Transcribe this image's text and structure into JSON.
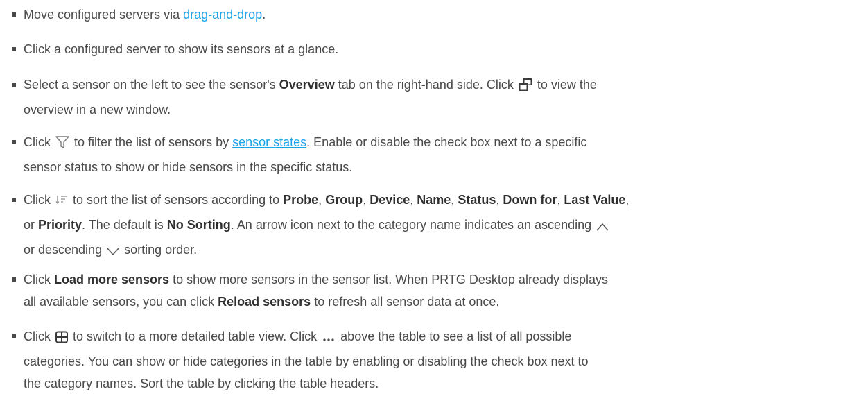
{
  "items": [
    {
      "t0": "Move configured servers via ",
      "link": "drag-and-drop",
      "t1": "."
    },
    {
      "t0": "Click a configured server to show its sensors at a glance."
    },
    {
      "t0": "Select a sensor on the left to see the sensor's ",
      "b0": "Overview",
      "t1": " tab on the right-hand side. Click ",
      "t2": " to view the",
      "t3": "overview in a new window."
    },
    {
      "t0": "Click ",
      "t1": " to filter the list of sensors by ",
      "link": "sensor states",
      "t2": ". Enable or disable the check box next to a specific",
      "t3": "sensor status to show or hide sensors in the specific status."
    },
    {
      "t0": "Click ",
      "t1": " to sort the list of sensors according to ",
      "probe": "Probe",
      "group": "Group",
      "device": "Device",
      "name": "Name",
      "status": "Status",
      "down_for": "Down for",
      "last_value": "Last Value",
      "priority": "Priority",
      "sep": ", ",
      "or": "or ",
      "default_pre": ". The default is ",
      "no_sorting": "No Sorting",
      "t2": ". An arrow icon next to the category name indicates an ascending",
      "t3": "or descending",
      "t4": " sorting order."
    },
    {
      "t0": "Click ",
      "b0": "Load more sensors",
      "t1": " to show more sensors in the sensor list. When PRTG Desktop already displays",
      "t2": "all available sensors, you can click ",
      "b1": "Reload sensors",
      "t3": " to refresh all sensor data at once."
    },
    {
      "t0": "Click ",
      "t1": " to switch to a more detailed table view. Click ",
      "t2": " above the table to see a list of all possible",
      "t3": "categories. You can show or hide categories in the table by enabling or disabling the check box next to",
      "t4": "the category names. Sort the table by clicking the table headers."
    }
  ],
  "icons": [
    "new-window-icon",
    "filter-icon",
    "sort-icon",
    "arrow-up-icon",
    "arrow-down-icon",
    "table-view-icon",
    "more-icon"
  ],
  "colors": {
    "text": "#4a4a4a",
    "link": "#1aa3e8",
    "bold": "#303030"
  }
}
